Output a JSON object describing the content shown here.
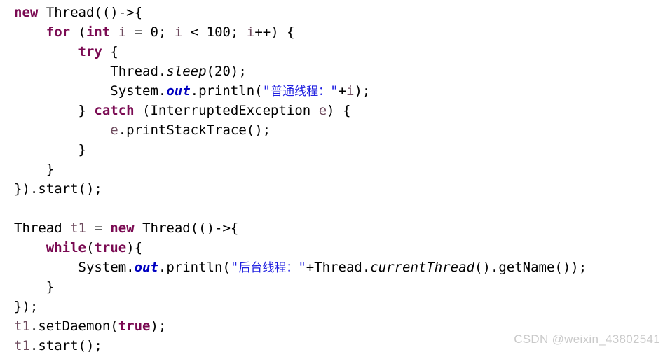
{
  "document": {
    "type": "java-code-snippet",
    "language": "Java",
    "background_color": "#ffffff",
    "colors": {
      "plain": "#000000",
      "keyword": "#7A0A52",
      "string": "#2020E0",
      "variable": "#6E4B5E",
      "static_field": "#0000C0",
      "watermark": "#C9C9C9"
    }
  },
  "code": {
    "lines": [
      {
        "index": 1,
        "text": "new Thread(()->{",
        "tokens": [
          {
            "t": "new",
            "k": "keyword"
          },
          {
            "t": " ",
            "k": "plain"
          },
          {
            "t": "Thread(()->{",
            "k": "plain"
          }
        ]
      },
      {
        "index": 2,
        "text": "    for (int i = 0; i < 100; i++) {",
        "tokens": [
          {
            "t": "    ",
            "k": "plain"
          },
          {
            "t": "for",
            "k": "keyword"
          },
          {
            "t": " (",
            "k": "plain"
          },
          {
            "t": "int",
            "k": "keyword"
          },
          {
            "t": " ",
            "k": "plain"
          },
          {
            "t": "i",
            "k": "var"
          },
          {
            "t": " = ",
            "k": "plain"
          },
          {
            "t": "0",
            "k": "number"
          },
          {
            "t": "; ",
            "k": "plain"
          },
          {
            "t": "i",
            "k": "var"
          },
          {
            "t": " < ",
            "k": "plain"
          },
          {
            "t": "100",
            "k": "number"
          },
          {
            "t": "; ",
            "k": "plain"
          },
          {
            "t": "i",
            "k": "var"
          },
          {
            "t": "++) {",
            "k": "plain"
          }
        ]
      },
      {
        "index": 3,
        "text": "        try {",
        "tokens": [
          {
            "t": "        ",
            "k": "plain"
          },
          {
            "t": "try",
            "k": "keyword"
          },
          {
            "t": " {",
            "k": "plain"
          }
        ]
      },
      {
        "index": 4,
        "text": "            Thread.sleep(20);",
        "tokens": [
          {
            "t": "            Thread.",
            "k": "plain"
          },
          {
            "t": "sleep",
            "k": "static"
          },
          {
            "t": "(",
            "k": "plain"
          },
          {
            "t": "20",
            "k": "number"
          },
          {
            "t": ");",
            "k": "plain"
          }
        ]
      },
      {
        "index": 5,
        "text": "            System.out.println(\"普通线程：\"+i);",
        "tokens": [
          {
            "t": "            System.",
            "k": "plain"
          },
          {
            "t": "out",
            "k": "field"
          },
          {
            "t": ".println(",
            "k": "plain"
          },
          {
            "t": "\"",
            "k": "string"
          },
          {
            "t": "普通线程：",
            "k": "cjk"
          },
          {
            "t": "\"",
            "k": "string"
          },
          {
            "t": "+",
            "k": "plain"
          },
          {
            "t": "i",
            "k": "var"
          },
          {
            "t": ");",
            "k": "plain"
          }
        ]
      },
      {
        "index": 6,
        "text": "        } catch (InterruptedException e) {",
        "tokens": [
          {
            "t": "        } ",
            "k": "plain"
          },
          {
            "t": "catch",
            "k": "keyword"
          },
          {
            "t": " (InterruptedException ",
            "k": "plain"
          },
          {
            "t": "e",
            "k": "var"
          },
          {
            "t": ") {",
            "k": "plain"
          }
        ]
      },
      {
        "index": 7,
        "text": "            e.printStackTrace();",
        "tokens": [
          {
            "t": "            ",
            "k": "plain"
          },
          {
            "t": "e",
            "k": "var"
          },
          {
            "t": ".printStackTrace();",
            "k": "plain"
          }
        ]
      },
      {
        "index": 8,
        "text": "        }",
        "tokens": [
          {
            "t": "        }",
            "k": "plain"
          }
        ]
      },
      {
        "index": 9,
        "text": "    }",
        "tokens": [
          {
            "t": "    }",
            "k": "plain"
          }
        ]
      },
      {
        "index": 10,
        "text": "}).start();",
        "tokens": [
          {
            "t": "}).start();",
            "k": "plain"
          }
        ]
      },
      {
        "index": 11,
        "text": "",
        "tokens": []
      },
      {
        "index": 12,
        "text": "Thread t1 = new Thread(()->{",
        "tokens": [
          {
            "t": "Thread ",
            "k": "plain"
          },
          {
            "t": "t1",
            "k": "var"
          },
          {
            "t": " = ",
            "k": "plain"
          },
          {
            "t": "new",
            "k": "keyword"
          },
          {
            "t": " Thread(()->{",
            "k": "plain"
          }
        ]
      },
      {
        "index": 13,
        "text": "    while(true){",
        "tokens": [
          {
            "t": "    ",
            "k": "plain"
          },
          {
            "t": "while",
            "k": "keyword"
          },
          {
            "t": "(",
            "k": "plain"
          },
          {
            "t": "true",
            "k": "keyword"
          },
          {
            "t": "){",
            "k": "plain"
          }
        ]
      },
      {
        "index": 14,
        "text": "        System.out.println(\"后台线程：\"+Thread.currentThread().getName());",
        "tokens": [
          {
            "t": "        System.",
            "k": "plain"
          },
          {
            "t": "out",
            "k": "field"
          },
          {
            "t": ".println(",
            "k": "plain"
          },
          {
            "t": "\"",
            "k": "string"
          },
          {
            "t": "后台线程：",
            "k": "cjk"
          },
          {
            "t": "\"",
            "k": "string"
          },
          {
            "t": "+Thread.",
            "k": "plain"
          },
          {
            "t": "currentThread",
            "k": "static"
          },
          {
            "t": "().getName());",
            "k": "plain"
          }
        ]
      },
      {
        "index": 15,
        "text": "    }",
        "tokens": [
          {
            "t": "    }",
            "k": "plain"
          }
        ]
      },
      {
        "index": 16,
        "text": "});",
        "tokens": [
          {
            "t": "});",
            "k": "plain"
          }
        ]
      },
      {
        "index": 17,
        "text": "t1.setDaemon(true);",
        "tokens": [
          {
            "t": "t1",
            "k": "var"
          },
          {
            "t": ".setDaemon(",
            "k": "plain"
          },
          {
            "t": "true",
            "k": "keyword"
          },
          {
            "t": ");",
            "k": "plain"
          }
        ]
      },
      {
        "index": 18,
        "text": "t1.start();",
        "tokens": [
          {
            "t": "t1",
            "k": "var"
          },
          {
            "t": ".start();",
            "k": "plain"
          }
        ]
      }
    ]
  },
  "watermark": {
    "text": "CSDN @weixin_43802541"
  }
}
